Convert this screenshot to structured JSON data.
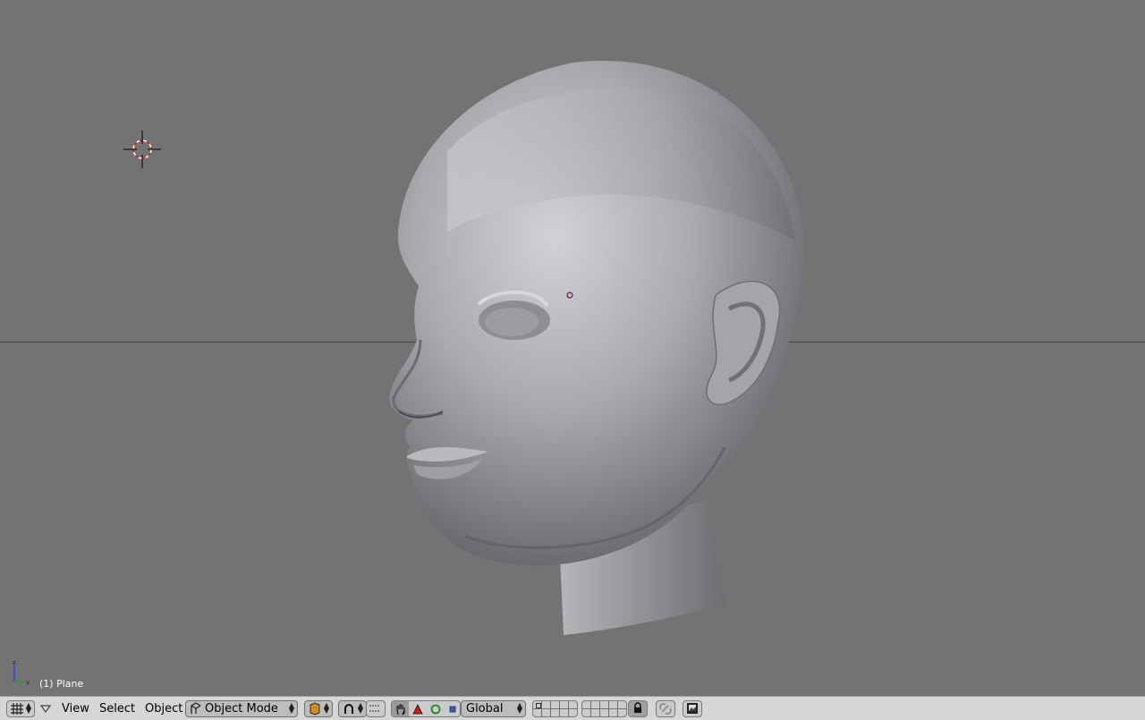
{
  "viewport": {
    "object_label": "(1) Plane",
    "axis_z": "z",
    "axis_y": "y",
    "background": "#737373"
  },
  "header": {
    "editor_type_icon": "grid-icon",
    "menu": {
      "view": "View",
      "select": "Select",
      "object": "Object"
    },
    "mode": {
      "label": "Object Mode",
      "icon": "object-mode-icon"
    },
    "draw_type_icon": "shading-solid-icon",
    "pivot_icon": "pivot-icon",
    "manipulator_icons": [
      "hand-icon",
      "translate-icon",
      "rotate-icon",
      "scale-icon"
    ],
    "orientation": "Global",
    "layers_row_count": 2,
    "lock_icon": "lock-icon",
    "render_icon": "render-icon"
  }
}
